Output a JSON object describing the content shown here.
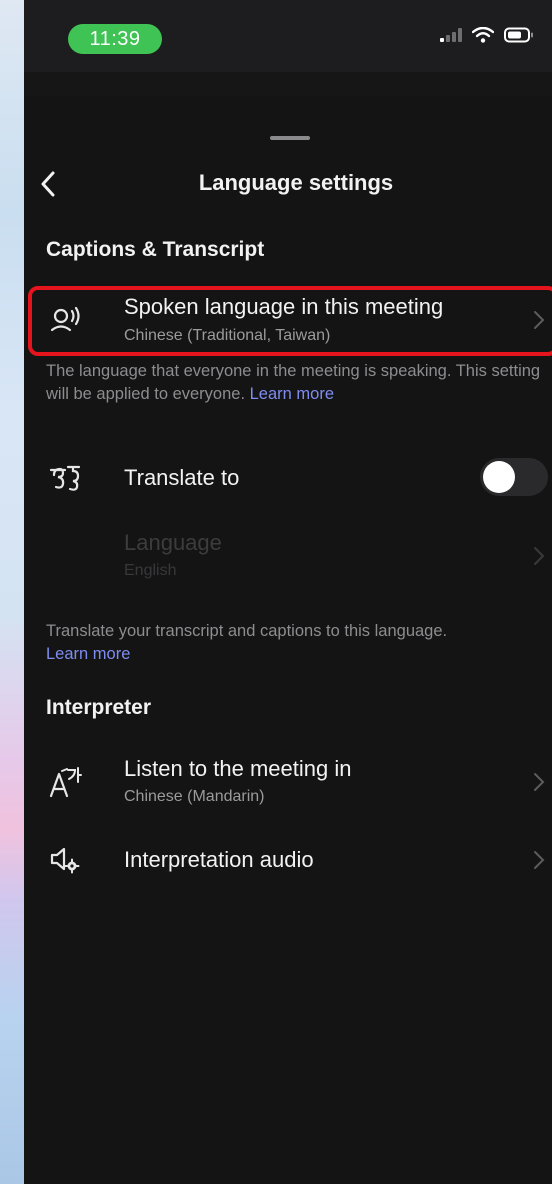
{
  "status_bar": {
    "time": "11:39"
  },
  "header": {
    "title": "Language settings"
  },
  "sections": {
    "captions": {
      "title": "Captions & Transcript",
      "spoken": {
        "title": "Spoken language in this meeting",
        "value": "Chinese (Traditional, Taiwan)"
      },
      "spoken_note": {
        "text": "The language that everyone in the meeting is speaking. This setting will be applied to everyone. ",
        "link": "Learn more"
      },
      "translate": {
        "title": "Translate to",
        "enabled": false
      },
      "language": {
        "title": "Language",
        "value": "English"
      },
      "translate_note": {
        "text": "Translate your transcript and captions to this language.",
        "link": "Learn more"
      }
    },
    "interpreter": {
      "title": "Interpreter",
      "listen": {
        "title": "Listen to the meeting in",
        "value": "Chinese (Mandarin)"
      },
      "audio": {
        "title": "Interpretation audio"
      }
    }
  },
  "colors": {
    "highlight": "#e5141d",
    "link": "#7f8cf0",
    "time_pill": "#3fc354"
  }
}
